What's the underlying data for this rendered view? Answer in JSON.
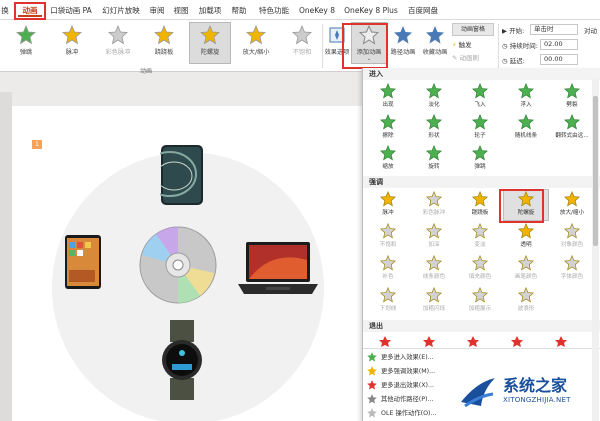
{
  "menu": {
    "tabs": [
      "换",
      "动画",
      "口袋动画 PA",
      "幻灯片放映",
      "审阅",
      "视图",
      "加载项",
      "帮助",
      "特色功能",
      "OneKey 8",
      "OneKey 8 Plus",
      "百度网盘"
    ],
    "active_tab": "动画"
  },
  "ribbon": {
    "effects": [
      {
        "label": "弹跳",
        "state": "normal"
      },
      {
        "label": "脉冲",
        "state": "normal"
      },
      {
        "label": "彩色脉冲",
        "state": "dim"
      },
      {
        "label": "跷跷板",
        "state": "normal"
      },
      {
        "label": "陀螺旋",
        "state": "selected"
      },
      {
        "label": "放大/缩小",
        "state": "normal"
      },
      {
        "label": "不饱和",
        "state": "dim"
      }
    ],
    "group_label": "动画",
    "effect_options": "效果选项",
    "add_animation": "添加动画",
    "custom_path": "路径动画",
    "favorite": "收藏动画",
    "animation_pane": "动画窗格",
    "trigger": "触发",
    "animation_painter": "动画刷",
    "start_label": "开始:",
    "start_value": "单击时",
    "duration_label": "持续时间:",
    "duration_value": "02.00",
    "delay_label": "延迟:",
    "delay_value": "00.00",
    "reorder_label": "对动"
  },
  "slide": {
    "tag": "1"
  },
  "panel": {
    "entrance_header": "进入",
    "entrance": [
      {
        "label": "出现",
        "color": "#4caf50"
      },
      {
        "label": "淡化",
        "color": "#4caf50"
      },
      {
        "label": "飞入",
        "color": "#4caf50"
      },
      {
        "label": "浮入",
        "color": "#4caf50"
      },
      {
        "label": "劈裂",
        "color": "#4caf50"
      },
      {
        "label": "擦除",
        "color": "#4caf50"
      },
      {
        "label": "形状",
        "color": "#4caf50"
      },
      {
        "label": "轮子",
        "color": "#4caf50"
      },
      {
        "label": "随机线条",
        "color": "#4caf50"
      },
      {
        "label": "翻转式由远...",
        "color": "#4caf50"
      },
      {
        "label": "缩放",
        "color": "#4caf50"
      },
      {
        "label": "旋转",
        "color": "#4caf50"
      },
      {
        "label": "弹跳",
        "color": "#4caf50"
      }
    ],
    "emphasis_header": "强调",
    "emphasis": [
      {
        "label": "脉冲",
        "state": "normal"
      },
      {
        "label": "彩色脉冲",
        "state": "dim"
      },
      {
        "label": "跷跷板",
        "state": "normal"
      },
      {
        "label": "陀螺旋",
        "state": "highlight"
      },
      {
        "label": "放大/缩小",
        "state": "normal"
      },
      {
        "label": "不饱和",
        "state": "dim"
      },
      {
        "label": "加深",
        "state": "dim"
      },
      {
        "label": "变淡",
        "state": "dim"
      },
      {
        "label": "透明",
        "state": "normal"
      },
      {
        "label": "对象颜色",
        "state": "dim"
      },
      {
        "label": "补色",
        "state": "dim"
      },
      {
        "label": "线条颜色",
        "state": "dim"
      },
      {
        "label": "填充颜色",
        "state": "dim"
      },
      {
        "label": "画笔颜色",
        "state": "dim"
      },
      {
        "label": "字体颜色",
        "state": "dim"
      },
      {
        "label": "下划线",
        "state": "dim"
      },
      {
        "label": "加粗闪烁",
        "state": "dim"
      },
      {
        "label": "加粗展示",
        "state": "dim"
      },
      {
        "label": "波浪形",
        "state": "dim"
      }
    ],
    "exit_header": "退出",
    "more": [
      {
        "label": "更多进入效果(E)...",
        "color": "#4caf50"
      },
      {
        "label": "更多强调效果(M)...",
        "color": "#f0b400"
      },
      {
        "label": "更多退出效果(X)...",
        "color": "#e0332e"
      },
      {
        "label": "其他动作路径(P)...",
        "color": "#888888"
      },
      {
        "label": "OLE 操作动作(O)...",
        "color": "#bbbbbb"
      }
    ]
  },
  "watermark": {
    "title": "系统之家",
    "subtitle": "XITONGZHIJIA.NET"
  }
}
